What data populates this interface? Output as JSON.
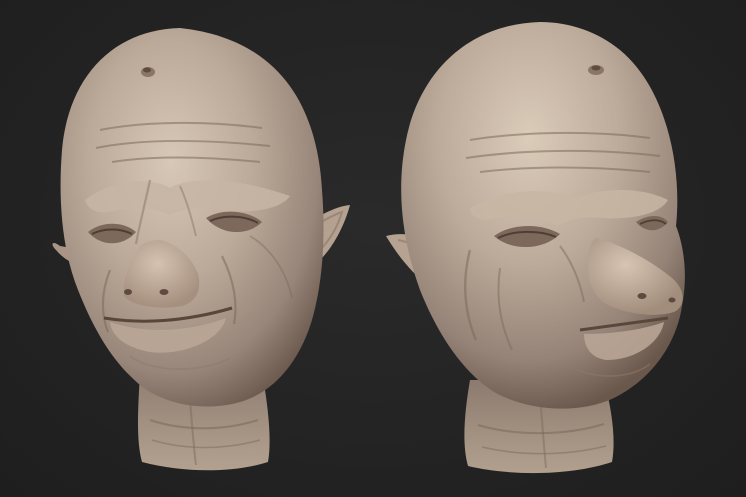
{
  "scene": {
    "background_color": "#232323",
    "subject": "sculpted-creature-heads",
    "views": [
      {
        "name": "front-three-quarter-view"
      },
      {
        "name": "side-three-quarter-view"
      }
    ],
    "colors": {
      "skin_base": "#b9a797",
      "skin_light": "#d6c6b5",
      "skin_shadow": "#7d6a5c",
      "crease": "#6b574a"
    }
  }
}
